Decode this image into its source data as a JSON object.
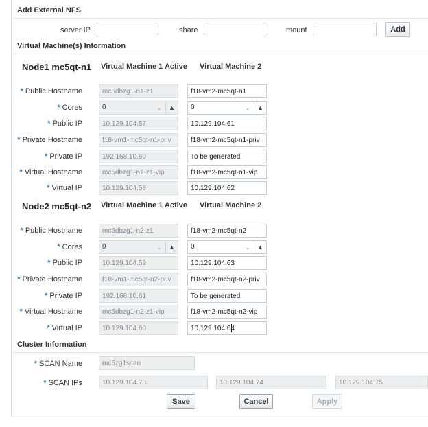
{
  "nfs": {
    "title": "Add External NFS",
    "server_ip_label": "server IP",
    "server_ip_value": "",
    "share_label": "share",
    "share_value": "",
    "mount_label": "mount",
    "mount_value": "",
    "add_label": "Add"
  },
  "vm_section": {
    "title": "Virtual Machine(s) Information"
  },
  "nodes": [
    {
      "title": "Node1 mc5qt-n1",
      "col1": "Virtual Machine 1 Active",
      "col2": "Virtual Machine 2",
      "public_hostname_label": "Public Hostname",
      "cores_label": "Cores",
      "public_ip_label": "Public IP",
      "private_hostname_label": "Private Hostname",
      "private_ip_label": "Private IP",
      "virtual_hostname_label": "Virtual Hostname",
      "virtual_ip_label": "Virtual IP",
      "vm1": {
        "public_hostname": "mc5dbzg1-n1-z1",
        "cores": "0",
        "public_ip": "10.129.104.57",
        "private_hostname": "f18-vm1-mc5qt-n1-priv",
        "private_ip": "192.168.10.60",
        "virtual_hostname": "mc5dbzg1-n1-z1-vip",
        "virtual_ip": "10.129.104.58"
      },
      "vm2": {
        "public_hostname": "f18-vm2-mc5qt-n1",
        "cores": "0",
        "public_ip": "10.129.104.61",
        "private_hostname": "f18-vm2-mc5qt-n1-priv",
        "private_ip": "To be generated",
        "virtual_hostname": "f18-vm2-mc5qt-n1-vip",
        "virtual_ip": "10.129.104.62"
      }
    },
    {
      "title": "Node2 mc5qt-n2",
      "col1": "Virtual Machine 1 Active",
      "col2": "Virtual Machine 2",
      "public_hostname_label": "Public Hostname",
      "cores_label": "Cores",
      "public_ip_label": "Public IP",
      "private_hostname_label": "Private Hostname",
      "private_ip_label": "Private IP",
      "virtual_hostname_label": "Virtual Hostname",
      "virtual_ip_label": "Virtual IP",
      "vm1": {
        "public_hostname": "mc5dbzg1-n2-z1",
        "cores": "0",
        "public_ip": "10.129.104.59",
        "private_hostname": "f18-vm1-mc5qt-n2-priv",
        "private_ip": "192.168.10.61",
        "virtual_hostname": "mc5dbzg1-n2-z1-vip",
        "virtual_ip": "10.129.104.60"
      },
      "vm2": {
        "public_hostname": "f18-vm2-mc5qt-n2",
        "cores": "0",
        "public_ip": "10.129.104.63",
        "private_hostname": "f18-vm2-mc5qt-n2-priv",
        "private_ip": "To be generated",
        "virtual_hostname": "f18-vm2-mc5qt-n2-vip",
        "virtual_ip": "10.129.104.64"
      }
    }
  ],
  "cluster": {
    "title": "Cluster Information",
    "scan_name_label": "SCAN Name",
    "scan_name_value": "mc5zg1scan",
    "scan_ips_label": "SCAN IPs",
    "scan_ips": [
      "10.129.104.73",
      "10.129.104.74",
      "10.129.104.75"
    ]
  },
  "actions": {
    "save": "Save",
    "cancel": "Cancel",
    "apply": "Apply"
  },
  "icons": {
    "spinner_down": "chevron-down-icon",
    "spinner_up": "chevron-up-icon"
  },
  "colors": {
    "required_star": "#2f7ec2",
    "readonly_bg": "#eceeef",
    "border": "#c4cdd5"
  }
}
